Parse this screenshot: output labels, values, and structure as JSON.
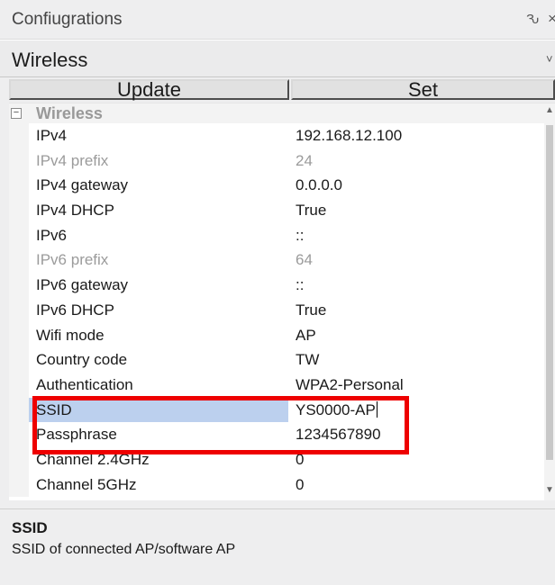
{
  "panel": {
    "title": "Confiugrations",
    "pin_glyph": "Ԅ",
    "close_glyph": "×"
  },
  "object_selector": {
    "value": "Wireless",
    "chevron": "˅"
  },
  "buttons": {
    "update": "Update",
    "set": "Set"
  },
  "grid": {
    "category": {
      "label": "Wireless",
      "toggle": "−"
    },
    "properties": [
      {
        "name": "IPv4",
        "value": "192.168.12.100",
        "readonly": false
      },
      {
        "name": "IPv4 prefix",
        "value": "24",
        "readonly": true
      },
      {
        "name": "IPv4 gateway",
        "value": "0.0.0.0",
        "readonly": false
      },
      {
        "name": "IPv4 DHCP",
        "value": "True",
        "readonly": false
      },
      {
        "name": "IPv6",
        "value": "::",
        "readonly": false
      },
      {
        "name": "IPv6 prefix",
        "value": "64",
        "readonly": true
      },
      {
        "name": "IPv6 gateway",
        "value": "::",
        "readonly": false
      },
      {
        "name": "IPv6 DHCP",
        "value": "True",
        "readonly": false
      },
      {
        "name": "Wifi mode",
        "value": "AP",
        "readonly": false
      },
      {
        "name": "Country code",
        "value": "TW",
        "readonly": false
      },
      {
        "name": "Authentication",
        "value": "WPA2-Personal",
        "readonly": false
      },
      {
        "name": "SSID",
        "value": "YS0000-AP",
        "readonly": false,
        "selected": true
      },
      {
        "name": "Passphrase",
        "value": "1234567890",
        "readonly": false
      },
      {
        "name": "Channel 2.4GHz",
        "value": "0",
        "readonly": false
      },
      {
        "name": "Channel 5GHz",
        "value": "0",
        "readonly": false
      }
    ]
  },
  "help": {
    "title": "SSID",
    "description": "SSID of connected AP/software AP"
  },
  "colors": {
    "selection": "#bcd0ee",
    "highlight": "#ee0000",
    "readonly_text": "#9b9b9b"
  }
}
